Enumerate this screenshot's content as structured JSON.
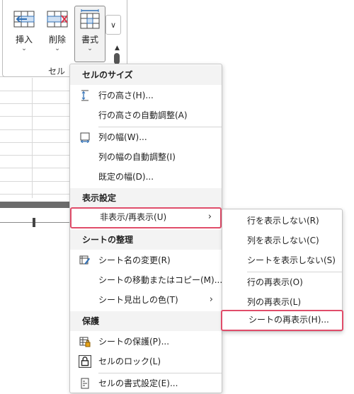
{
  "ribbon": {
    "buttons": [
      {
        "label": "挿入",
        "caret": "⌄",
        "icon": "insert-cells-icon"
      },
      {
        "label": "削除",
        "caret": "⌄",
        "icon": "delete-cells-icon"
      },
      {
        "label": "書式",
        "caret": "⌄",
        "icon": "format-cells-icon"
      }
    ],
    "group_label": "セル",
    "dropdown_glyph": "∨",
    "scroll_up": "▲"
  },
  "menu": {
    "sections": {
      "cell_size": "セルのサイズ",
      "visibility": "表示設定",
      "organize": "シートの整理",
      "protection": "保護"
    },
    "items": {
      "row_height": "行の高さ(H)...",
      "autofit_row": "行の高さの自動調整(A)",
      "column_width": "列の幅(W)...",
      "autofit_column": "列の幅の自動調整(I)",
      "default_width": "既定の幅(D)...",
      "hide_unhide": "非表示/再表示(U)",
      "rename_sheet": "シート名の変更(R)",
      "move_copy_sheet": "シートの移動またはコピー(M)...",
      "tab_color": "シート見出しの色(T)",
      "protect_sheet": "シートの保護(P)...",
      "lock_cell": "セルのロック(L)",
      "format_cells": "セルの書式設定(E)..."
    },
    "arrow": "›"
  },
  "submenu": {
    "items": {
      "hide_rows": "行を表示しない(R)",
      "hide_columns": "列を表示しない(C)",
      "hide_sheet": "シートを表示しない(S)",
      "unhide_rows": "行の再表示(O)",
      "unhide_columns": "列の再表示(L)",
      "unhide_sheet": "シートの再表示(H)..."
    }
  },
  "colors": {
    "highlight_border": "#e04d6a",
    "section_bg": "#f3f3f3",
    "icon_blue": "#2f6fb5",
    "delete_red": "#d9344b",
    "accent_green": "#1d7a3e"
  }
}
